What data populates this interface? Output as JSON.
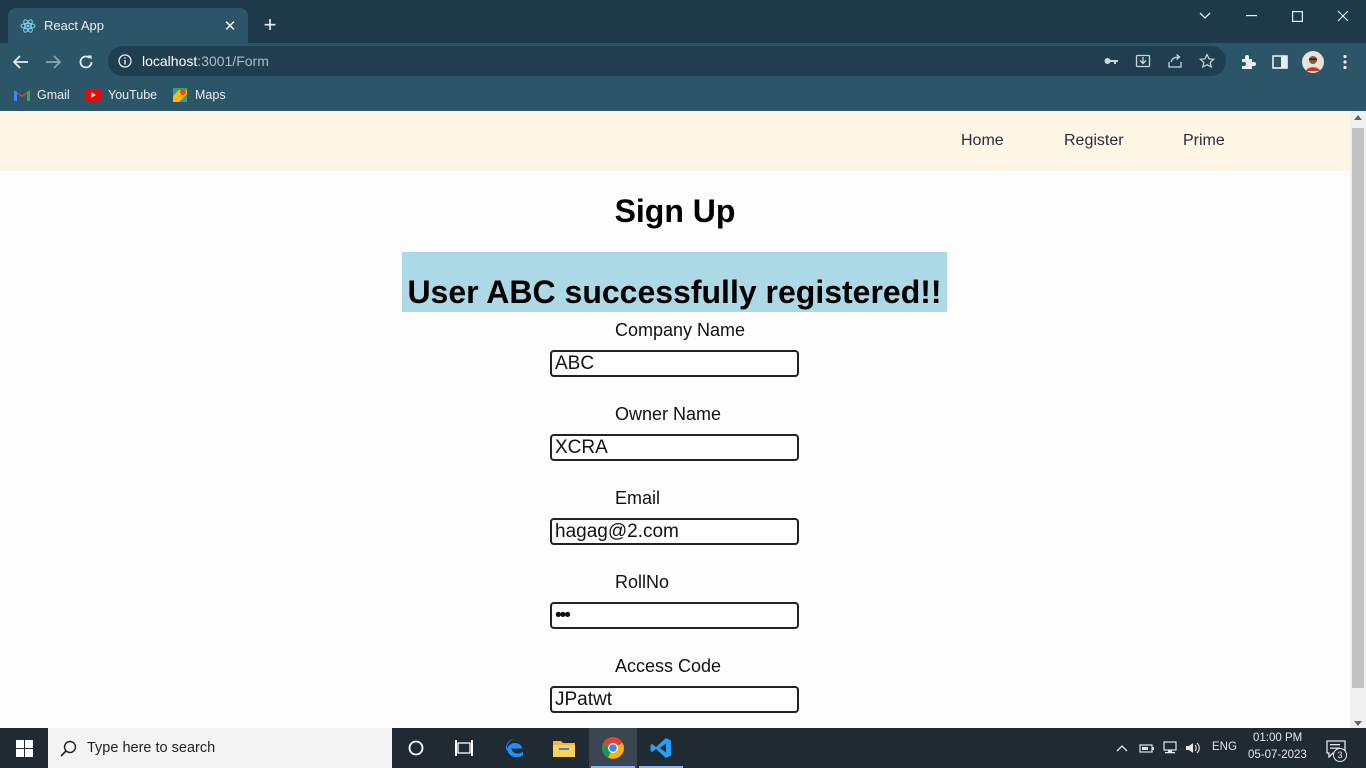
{
  "browser": {
    "tab": {
      "title": "React App"
    },
    "address": {
      "host": "localhost",
      "path": ":3001/Form"
    },
    "bookmarks": [
      {
        "label": "Gmail"
      },
      {
        "label": "YouTube"
      },
      {
        "label": "Maps"
      }
    ]
  },
  "navbar": {
    "links": [
      {
        "label": "Home"
      },
      {
        "label": "Register"
      },
      {
        "label": "Prime"
      }
    ]
  },
  "form": {
    "heading": "Sign Up",
    "success_message": "User ABC successfully registered!!",
    "fields": [
      {
        "label": "Company Name",
        "value": "ABC",
        "type": "text"
      },
      {
        "label": "Owner Name",
        "value": "XCRA",
        "type": "text"
      },
      {
        "label": "Email",
        "value": "hagag@2.com",
        "type": "text"
      },
      {
        "label": "RollNo",
        "value": "123",
        "type": "password"
      },
      {
        "label": "Access Code",
        "value": "JPatwt",
        "type": "text"
      }
    ]
  },
  "taskbar": {
    "search_placeholder": "Type here to search",
    "language": "ENG",
    "time": "01:00 PM",
    "date": "05-07-2023",
    "notification_count": "3"
  },
  "colors": {
    "navbar_bg": "#fff7e6",
    "success_bg": "#add8e6",
    "chrome_bg": "#2c5568"
  }
}
